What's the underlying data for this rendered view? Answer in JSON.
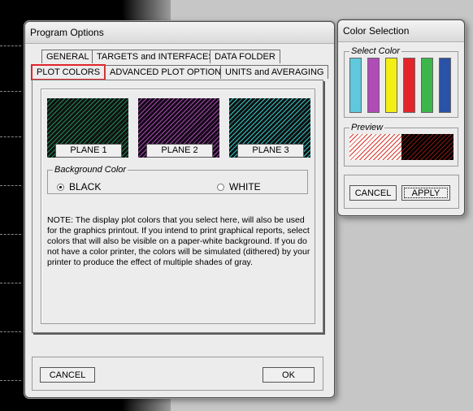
{
  "program_options": {
    "title": "Program Options",
    "tabs_row1": [
      "GENERAL",
      "TARGETS and INTERFACES",
      "DATA FOLDER"
    ],
    "tabs_row2": [
      "PLOT COLORS",
      "ADVANCED PLOT OPTIONS",
      "UNITS and AVERAGING"
    ],
    "planes": [
      {
        "label": "PLANE 1",
        "color": "#1e8a5a"
      },
      {
        "label": "PLANE 2",
        "color": "#a44aa8"
      },
      {
        "label": "PLANE 3",
        "color": "#2fc6c6"
      }
    ],
    "background_color": {
      "legend": "Background Color",
      "black_label": "BLACK",
      "white_label": "WHITE",
      "selected": "BLACK"
    },
    "note": "NOTE: The display plot colors that you select here, will also be used for the graphics printout. If you intend to print graphical reports, select colors that will also be visible on a paper-white background. If you do not have a color printer, the colors will be simulated (dithered) by your printer to produce the effect of multiple shades of gray.",
    "cancel_label": "CANCEL",
    "ok_label": "OK"
  },
  "color_selection": {
    "title": "Color Selection",
    "select_color_legend": "Select Color",
    "colors": [
      "#5fc8dc",
      "#b04cb6",
      "#f3ef14",
      "#e3242b",
      "#3cb54a",
      "#2a52a6"
    ],
    "preview_legend": "Preview",
    "preview_left": "#d8352a",
    "preview_right": "#000000",
    "cancel_label": "CANCEL",
    "apply_label": "APPLY"
  }
}
